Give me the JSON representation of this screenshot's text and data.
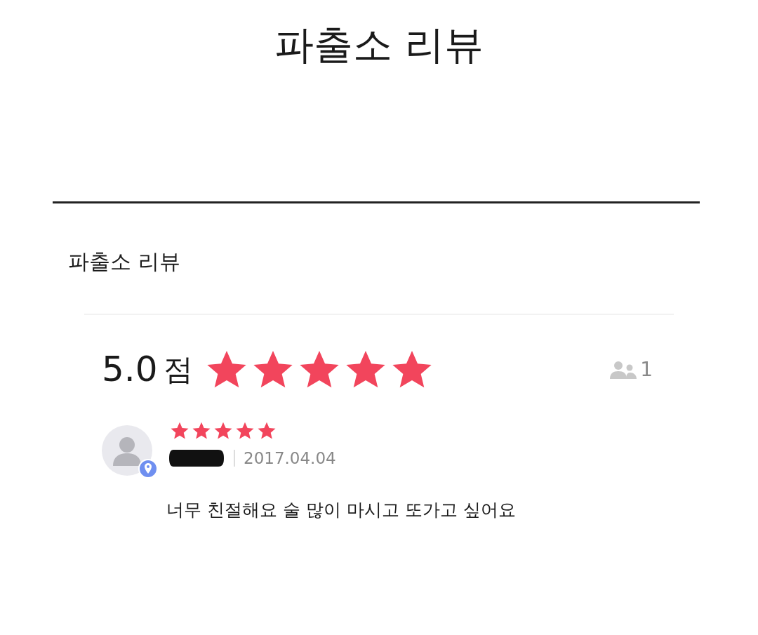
{
  "page_title": "파출소 리뷰",
  "section_title": "파출소 리뷰",
  "rating": {
    "score": "5.0",
    "unit": "점",
    "stars": 5,
    "reviewer_count": "1"
  },
  "reviews": [
    {
      "stars": 5,
      "date": "2017.04.04",
      "text": "너무 친절해요 술 많이 마시고 또가고 싶어요"
    }
  ]
}
